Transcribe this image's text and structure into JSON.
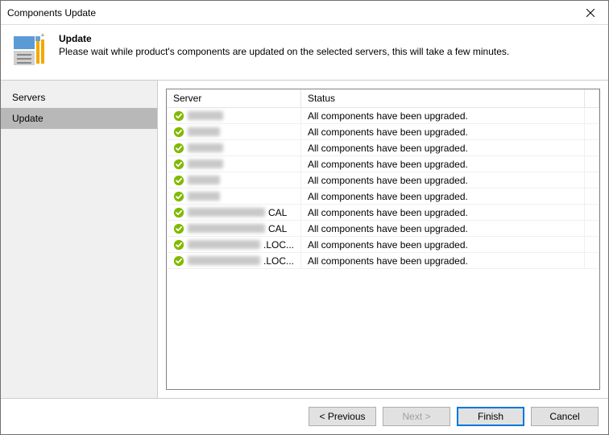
{
  "window": {
    "title": "Components Update"
  },
  "header": {
    "title": "Update",
    "description": "Please wait while product's components are updated on the selected servers, this will take a few minutes."
  },
  "sidebar": {
    "items": [
      {
        "label": "Servers",
        "selected": false
      },
      {
        "label": "Update",
        "selected": true
      }
    ]
  },
  "table": {
    "columns": [
      "Server",
      "Status"
    ],
    "rows": [
      {
        "server": "",
        "suffix": "",
        "blur_w": 44,
        "status": "All components have been upgraded."
      },
      {
        "server": "",
        "suffix": "",
        "blur_w": 40,
        "status": "All components have been upgraded."
      },
      {
        "server": "",
        "suffix": "",
        "blur_w": 44,
        "status": "All components have been upgraded."
      },
      {
        "server": "",
        "suffix": "",
        "blur_w": 44,
        "status": "All components have been upgraded."
      },
      {
        "server": "",
        "suffix": "",
        "blur_w": 40,
        "status": "All components have been upgraded."
      },
      {
        "server": "",
        "suffix": "",
        "blur_w": 40,
        "status": "All components have been upgraded."
      },
      {
        "server": "",
        "suffix": "CAL",
        "blur_w": 96,
        "status": "All components have been upgraded."
      },
      {
        "server": "",
        "suffix": "CAL",
        "blur_w": 96,
        "status": "All components have been upgraded."
      },
      {
        "server": "",
        "suffix": ".LOC...",
        "blur_w": 90,
        "status": "All components have been upgraded."
      },
      {
        "server": "",
        "suffix": ".LOC...",
        "blur_w": 90,
        "status": "All components have been upgraded."
      }
    ]
  },
  "footer": {
    "previous": "< Previous",
    "next": "Next >",
    "finish": "Finish",
    "cancel": "Cancel"
  }
}
